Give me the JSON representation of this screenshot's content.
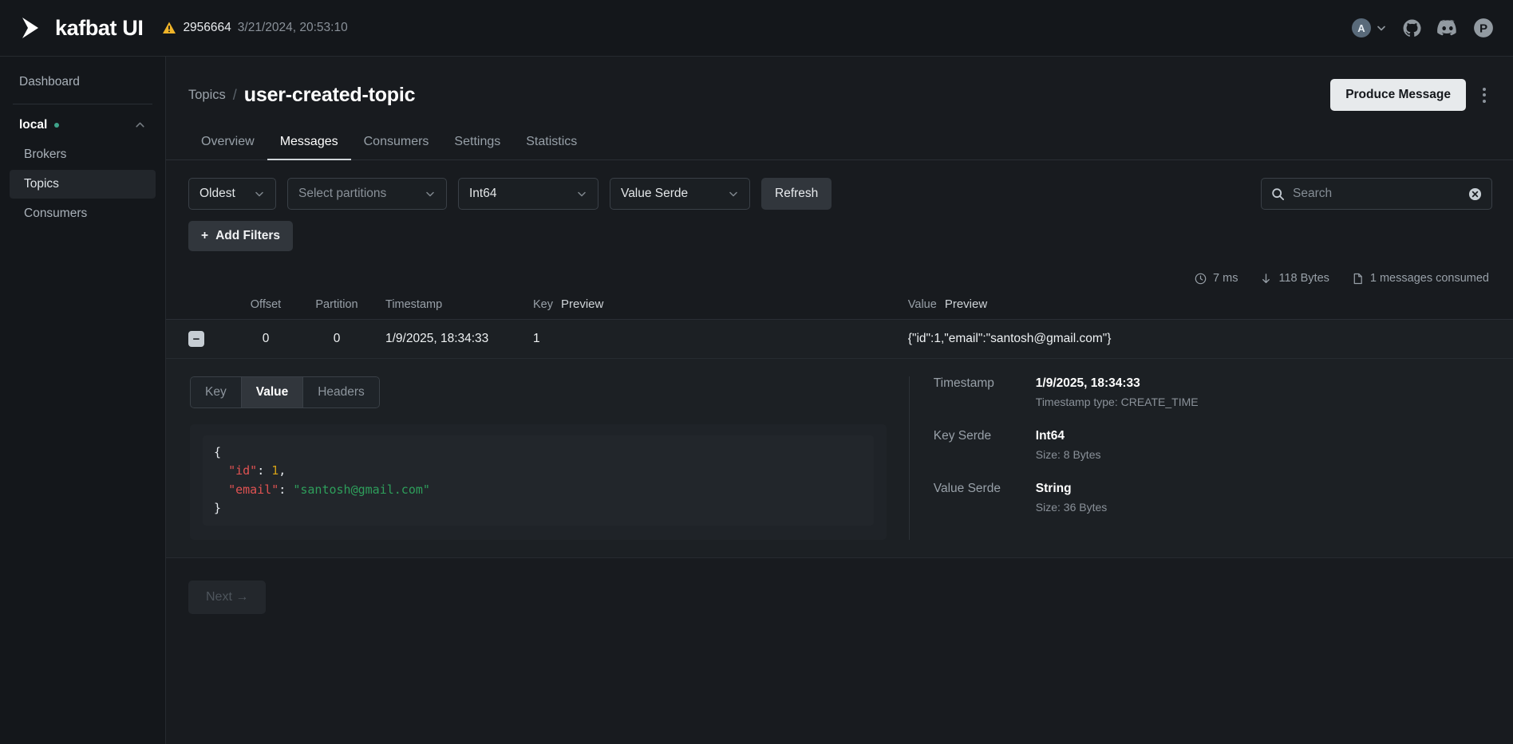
{
  "navbar": {
    "brand": "kafbat UI",
    "logo_icon": "kafbat-arrow-logo",
    "warning_icon": "warning-triangle-icon",
    "version": "2956664",
    "build_date": "3/21/2024, 20:53:10",
    "avatar_letter": "A",
    "chevron_icon": "chevron-down-icon",
    "github_icon": "github-icon",
    "discord_icon": "discord-icon",
    "product_icon": "p-circle-icon"
  },
  "sidebar": {
    "dashboard": "Dashboard",
    "cluster": "local",
    "cluster_collapse_icon": "chevron-up-icon",
    "items": [
      {
        "label": "Brokers",
        "active": false
      },
      {
        "label": "Topics",
        "active": true
      },
      {
        "label": "Consumers",
        "active": false
      }
    ]
  },
  "header": {
    "breadcrumb_parent": "Topics",
    "breadcrumb_separator": "/",
    "title": "user-created-topic",
    "produce_button": "Produce Message",
    "kebab_icon": "more-vertical-icon"
  },
  "tabs": [
    {
      "label": "Overview",
      "active": false
    },
    {
      "label": "Messages",
      "active": true
    },
    {
      "label": "Consumers",
      "active": false
    },
    {
      "label": "Settings",
      "active": false
    },
    {
      "label": "Statistics",
      "active": false
    }
  ],
  "filters": {
    "seek_type": "Oldest",
    "partitions_placeholder": "Select partitions",
    "key_serde": "Int64",
    "value_serde": "Value Serde",
    "refresh_button": "Refresh",
    "add_filters_button": "Add Filters",
    "add_filters_plus": "+",
    "chevron_icon": "chevron-down-icon"
  },
  "search": {
    "placeholder": "Search",
    "value": "",
    "search_icon": "search-icon",
    "clear_icon": "clear-circle-icon"
  },
  "stats": {
    "elapsed": "7 ms",
    "elapsed_icon": "clock-icon",
    "bytes": "118 Bytes",
    "bytes_icon": "download-arrow-icon",
    "consumed": "1 messages consumed",
    "consumed_icon": "file-icon"
  },
  "table": {
    "columns": {
      "offset": "Offset",
      "partition": "Partition",
      "timestamp": "Timestamp",
      "key": "Key",
      "key_preview": "Preview",
      "value": "Value",
      "value_preview": "Preview"
    },
    "rows": [
      {
        "toggle": "−",
        "offset": "0",
        "partition": "0",
        "timestamp": "1/9/2025, 18:34:33",
        "key": "1",
        "value": "{\"id\":1,\"email\":\"santosh@gmail.com\"}"
      }
    ]
  },
  "detail": {
    "segments": [
      {
        "label": "Key",
        "active": false
      },
      {
        "label": "Value",
        "active": true
      },
      {
        "label": "Headers",
        "active": false
      }
    ],
    "code": {
      "line1": "{",
      "line2_key": "\"id\"",
      "line2_colon": ": ",
      "line2_num": "1",
      "line2_comma": ",",
      "line3_key": "\"email\"",
      "line3_colon": ": ",
      "line3_str": "\"santosh@gmail.com\"",
      "line4": "}"
    },
    "meta": [
      {
        "label": "Timestamp",
        "main": "1/9/2025, 18:34:33",
        "sub": "Timestamp type: CREATE_TIME"
      },
      {
        "label": "Key Serde",
        "main": "Int64",
        "sub": "Size: 8 Bytes"
      },
      {
        "label": "Value Serde",
        "main": "String",
        "sub": "Size: 36 Bytes"
      }
    ]
  },
  "pager": {
    "next_label": "Next →"
  },
  "colors": {
    "accent": "#e7eaec",
    "cluster_online": "#3fa38a",
    "warning": "#f0b429",
    "json_key": "#e05252",
    "json_number": "#d4a017",
    "json_string": "#2e9e5b"
  }
}
